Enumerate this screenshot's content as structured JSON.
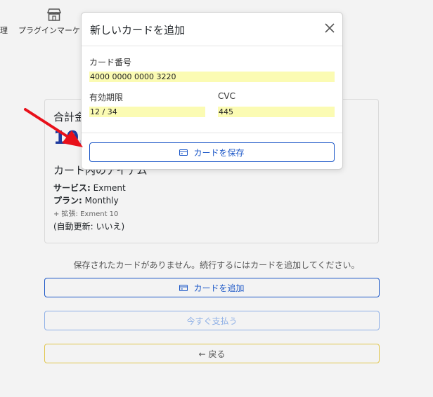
{
  "nav": {
    "left_text": "理",
    "market_text": "プラグインマーケット"
  },
  "summary": {
    "total_label": "合計金",
    "amount": "10,",
    "items_heading": "カート内のアイテム",
    "service_label": "サービス:",
    "service_value": "Exment",
    "plan_label": "プラン:",
    "plan_value": "Monthly",
    "extension": "+ 拡張: Exment 10",
    "auto_renew": "(自動更新: いいえ)"
  },
  "page": {
    "no_cards_message": "保存されたカードがありません。続行するにはカードを追加してください。",
    "add_card_label": "カードを追加",
    "pay_now_label": "今すぐ支払う",
    "back_label": "← 戻る"
  },
  "modal": {
    "title": "新しいカードを追加",
    "card_number_label": "カード番号",
    "card_number_value": "4000 0000 0000 3220",
    "expiry_label": "有効期限",
    "expiry_value": "12 / 34",
    "cvc_label": "CVC",
    "cvc_value": "445",
    "save_label": "カードを保存"
  },
  "colors": {
    "accent": "#1a56c7",
    "autofill": "#fbfbb3",
    "arrow": "#e8101a",
    "amount": "#1e3a9e"
  }
}
